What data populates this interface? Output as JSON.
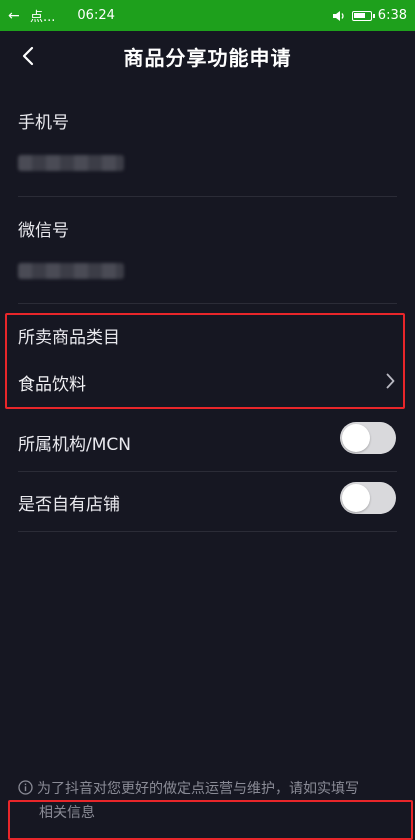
{
  "status_bar": {
    "back_glyph": "←",
    "app_name": "点...",
    "time_left": "06:24",
    "time_right": "6:38",
    "bar_color": "#1ea01c",
    "battery_level": 0.75,
    "icons": [
      "back-arrow-icon",
      "volume-icon",
      "battery-icon"
    ]
  },
  "header": {
    "title": "商品分享功能申请",
    "back_icon": "chevron-left-icon"
  },
  "form": {
    "phone": {
      "label": "手机号"
    },
    "wechat": {
      "label": "微信号"
    },
    "category": {
      "label": "所卖商品类目",
      "value": "食品饮料",
      "icon": "chevron-right-icon"
    },
    "mcn": {
      "label": "所属机构/MCN",
      "enabled": false
    },
    "own_store": {
      "label": "是否自有店铺",
      "enabled": false
    }
  },
  "notice": {
    "icon": "info-icon",
    "line1": "为了抖音对您更好的做定点运营与维护，请如实填写",
    "line2": "相关信息"
  },
  "colors": {
    "background": "#161722",
    "highlight_border": "#e8262a",
    "toggle_track": "#d9d9dc"
  }
}
